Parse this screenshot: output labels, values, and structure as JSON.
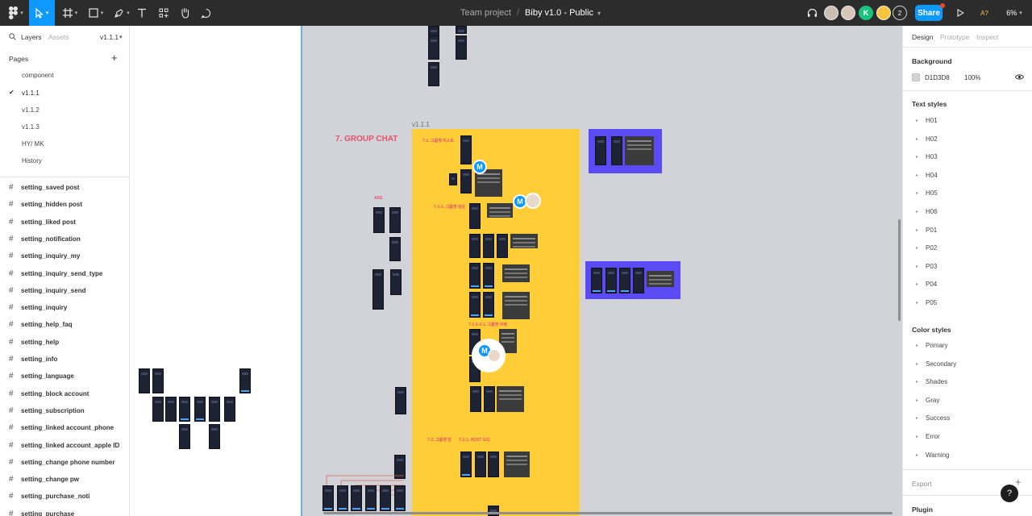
{
  "toolbar": {
    "project": "Team project",
    "separator": "/",
    "file_name": "Biby v1.0 - Public",
    "share_label": "Share",
    "collaborators": [
      "avatar-photo-1",
      "avatar-photo-2",
      "K",
      "avatar-photo-3"
    ],
    "collaborator_count": "2",
    "font_indicator": "A?",
    "zoom": "6%"
  },
  "left_panel": {
    "tabs": {
      "layers": "Layers",
      "assets": "Assets",
      "version": "v1.1.1"
    },
    "pages_heading": "Pages",
    "pages": [
      "component",
      "v1.1.1",
      "v1.1.2",
      "v1.1.3",
      "HY/ MK",
      "History"
    ],
    "selected_page": "v1.1.1",
    "layers": [
      "setting_saved post",
      "setting_hidden post",
      "setting_liked post",
      "setting_notification",
      "setting_inquiry_my",
      "setting_inquiry_send_type",
      "setting_inquiry_send",
      "setting_inquiry",
      "setting_help_faq",
      "setting_help",
      "setting_info",
      "setting_language",
      "setting_block account",
      "setting_subscription",
      "setting_linked account_phone",
      "setting_linked account_apple ID",
      "setting_change phone number",
      "setting_change pw",
      "setting_purchase_noti",
      "setting_purchase"
    ]
  },
  "canvas": {
    "frame_label": "v1.1.1",
    "section_title": "7. GROUP CHAT",
    "labels": {
      "group_list": "7-1. 그룹챗 리스트",
      "group_create": "7-1-1. 그룹챗 생성",
      "group_delete": "7-1-3-2-1. 그룹챗 삭제",
      "group_room": "7-2. 그룹챗 방",
      "host_label": "7-2-1. HOST 모드",
      "ass": "ASS"
    },
    "cursor_initial": "M",
    "colors": {
      "yellow_section": "#ffcd38",
      "purple_section": "#5b4bf5",
      "canvas_bg": "#d1d3d8"
    }
  },
  "right_panel": {
    "tabs": {
      "design": "Design",
      "prototype": "Prototype",
      "inspect": "Inspect"
    },
    "background": {
      "heading": "Background",
      "hex": "D1D3D8",
      "opacity": "100%"
    },
    "text_styles_heading": "Text styles",
    "text_styles": [
      "H01",
      "H02",
      "H03",
      "H04",
      "H05",
      "H06",
      "P01",
      "P02",
      "P03",
      "P04",
      "P05"
    ],
    "color_styles_heading": "Color styles",
    "color_styles": [
      "Primary",
      "Secondary",
      "Shades",
      "Gray",
      "Success",
      "Error",
      "Warning"
    ],
    "export_label": "Export",
    "plugin_label": "Plugin",
    "help_label": "?"
  }
}
